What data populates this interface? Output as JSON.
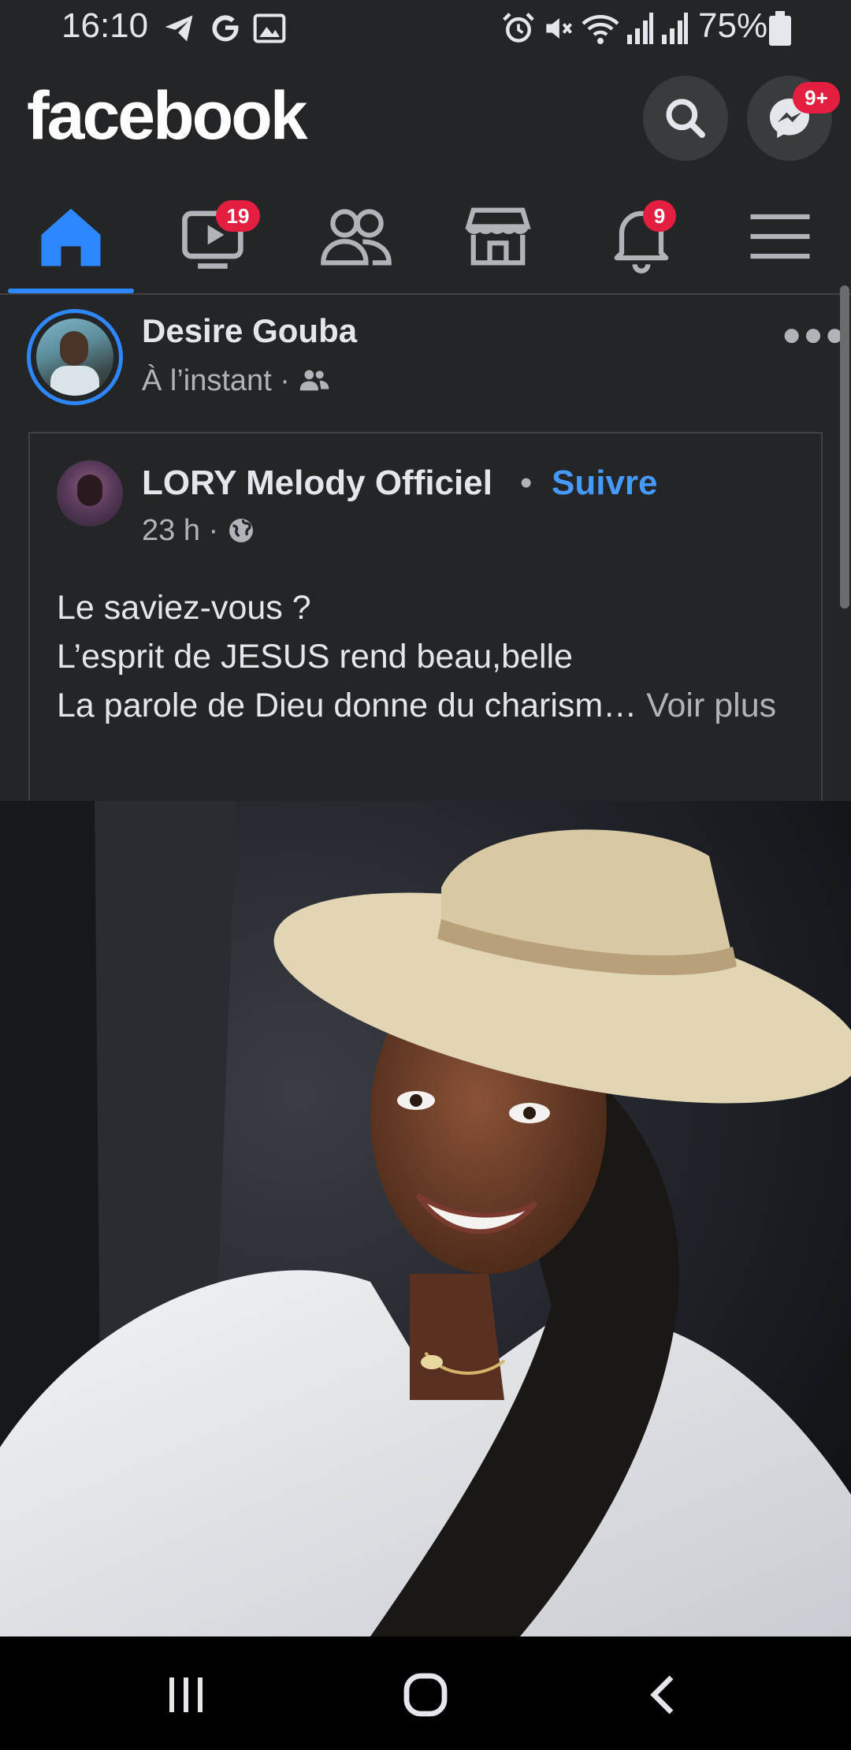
{
  "status_bar": {
    "time": "16:10",
    "battery": "75%",
    "left_icons": [
      "telegram-icon",
      "google-icon",
      "gallery-icon"
    ],
    "right_icons": [
      "alarm-icon",
      "mute-icon",
      "wifi-icon",
      "signal-icon",
      "signal-icon",
      "battery-icon"
    ]
  },
  "header": {
    "logo": "facebook",
    "search_icon": "search-icon",
    "messenger_icon": "messenger-icon",
    "messenger_badge": "9+"
  },
  "tabs": [
    {
      "name": "home",
      "icon": "home-icon",
      "active": true,
      "badge": ""
    },
    {
      "name": "watch",
      "icon": "video-icon",
      "active": false,
      "badge": "19"
    },
    {
      "name": "friends",
      "icon": "friends-icon",
      "active": false,
      "badge": ""
    },
    {
      "name": "marketplace",
      "icon": "marketplace-icon",
      "active": false,
      "badge": ""
    },
    {
      "name": "notifications",
      "icon": "bell-icon",
      "active": false,
      "badge": "9"
    },
    {
      "name": "menu",
      "icon": "menu-icon",
      "active": false,
      "badge": ""
    }
  ],
  "post": {
    "author": "Desire Gouba",
    "time": "À l’instant",
    "audience_icon": "friends-icon",
    "more_icon": "more-icon",
    "shared": {
      "page_name": "LORY Melody Officiel",
      "separator": "•",
      "follow_label": "Suivre",
      "time": "23 h",
      "audience_icon": "globe-icon",
      "lines": [
        "Le saviez-vous ?",
        "L’esprit de JESUS rend beau,belle",
        "La parole de Dieu donne du charism…"
      ],
      "see_more": "Voir plus"
    }
  },
  "colors": {
    "background": "#242526",
    "accent": "#2d88ff",
    "link": "#4599ff",
    "badge": "#e41e3f",
    "secondary_text": "#b0b3b8"
  },
  "nav": {
    "icons": [
      "recent-apps-icon",
      "home-circle-icon",
      "back-icon"
    ]
  }
}
